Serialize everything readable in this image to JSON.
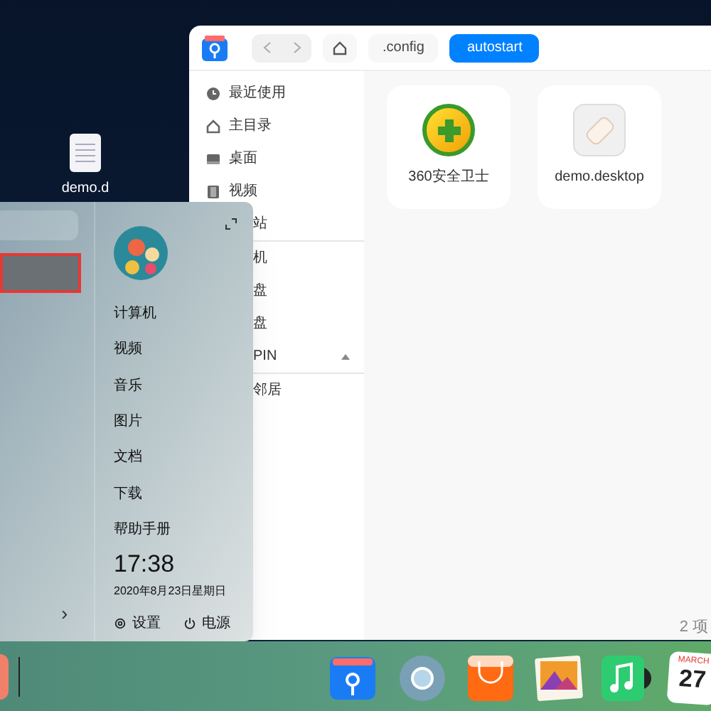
{
  "desktop_icons": [
    {
      "label": "demo.d"
    }
  ],
  "file_manager": {
    "breadcrumbs": [
      {
        "label": ".config",
        "selected": false
      },
      {
        "label": "autostart",
        "selected": true
      }
    ],
    "sidebar": [
      {
        "kind": "clock",
        "label": "最近使用"
      },
      {
        "kind": "home",
        "label": "主目录"
      },
      {
        "kind": "desktop",
        "label": "桌面"
      },
      {
        "kind": "video",
        "label": "视频"
      },
      {
        "kind": "cut",
        "label": "站",
        "divider": true
      },
      {
        "kind": "cut",
        "label": "机"
      },
      {
        "kind": "cut",
        "label": "盘"
      },
      {
        "kind": "cut",
        "label": "盘"
      },
      {
        "kind": "cut",
        "label": "PIN",
        "eject": true,
        "divider": true
      },
      {
        "kind": "cut",
        "label": "邻居"
      }
    ],
    "files": [
      {
        "label": "360安全卫士",
        "kind": "shield"
      },
      {
        "label": "demo.desktop",
        "kind": "tag"
      }
    ],
    "status": "2 项"
  },
  "start_menu": {
    "places": [
      "计算机",
      "视频",
      "音乐",
      "图片",
      "文档",
      "下载",
      "帮助手册"
    ],
    "time": "17:38",
    "date": "2020年8月23日星期日",
    "settings": "设置",
    "power": "电源",
    "more": "›"
  },
  "dock": {
    "calendar_month": "MARCH",
    "calendar_day": "27"
  }
}
